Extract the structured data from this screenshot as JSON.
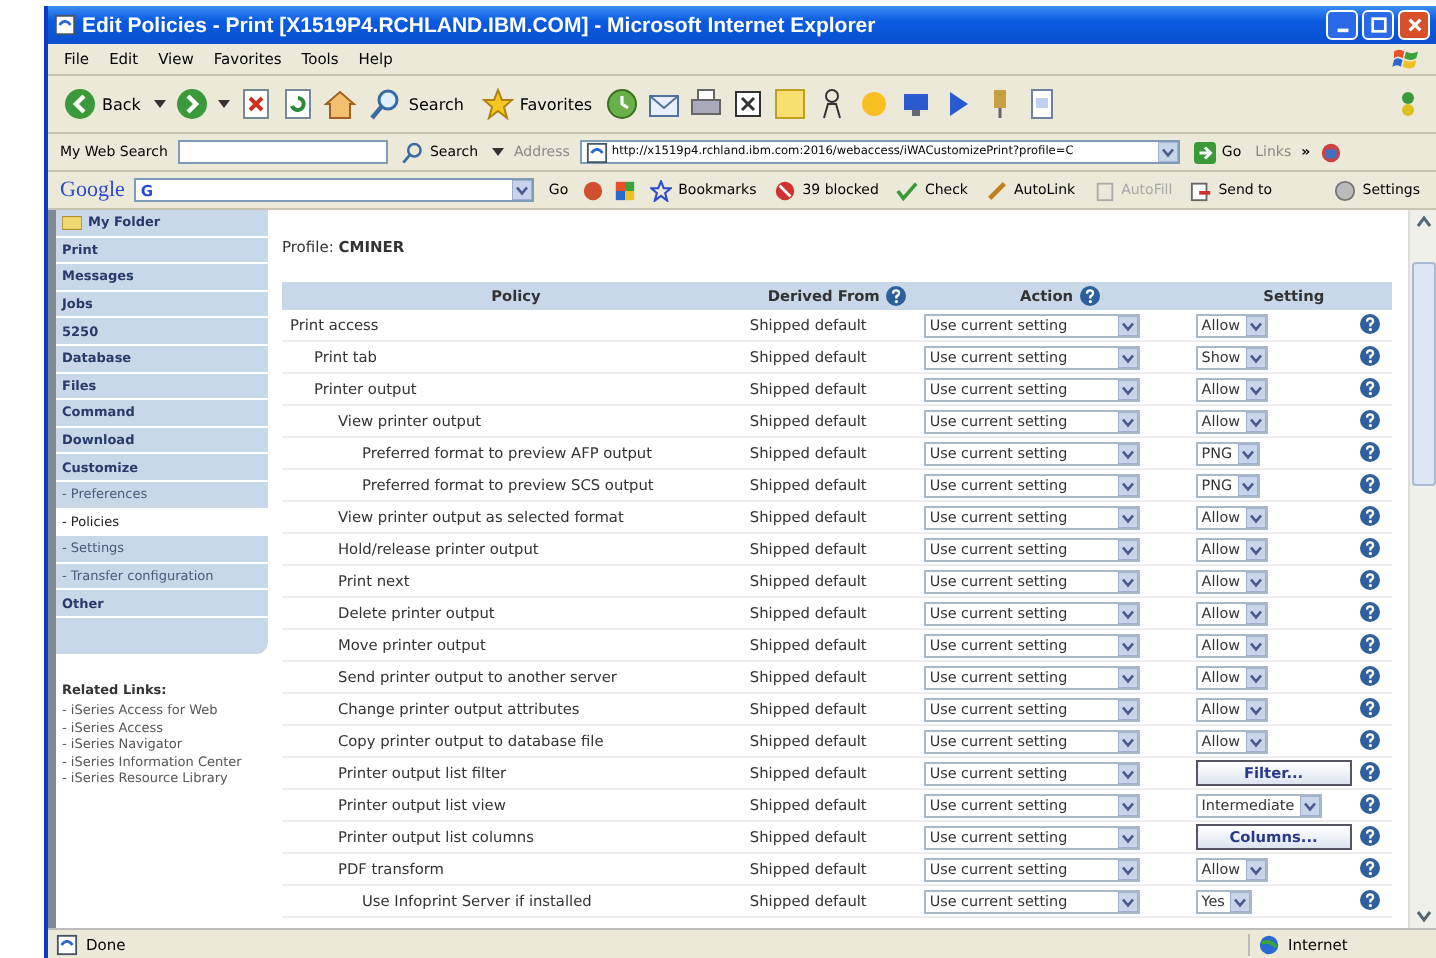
{
  "window": {
    "title": "Edit Policies - Print [X1519P4.RCHLAND.IBM.COM] - Microsoft Internet Explorer"
  },
  "menu": [
    "File",
    "Edit",
    "View",
    "Favorites",
    "Tools",
    "Help"
  ],
  "toolbar": {
    "back": "Back",
    "search": "Search",
    "favorites": "Favorites"
  },
  "address_bar": {
    "search_label": "My Web Search",
    "search_button": "Search",
    "address_label": "Address",
    "url": "http://x1519p4.rchland.ibm.com:2016/webaccess/iWACustomizePrint?profile=C",
    "go": "Go",
    "links": "Links",
    "links_more": "»"
  },
  "google_bar": {
    "logo": "Google",
    "field": "G",
    "go": "Go",
    "bookmarks": "Bookmarks",
    "blocked": "39 blocked",
    "check": "Check",
    "autolink": "AutoLink",
    "autofill": "AutoFill",
    "autofill_disabled": true,
    "send_to": "Send to",
    "settings": "Settings"
  },
  "sidebar": {
    "items": [
      {
        "label": "My Folder",
        "kind": "folder",
        "selected": false
      },
      {
        "label": "Print",
        "kind": "main",
        "selected": false
      },
      {
        "label": "Messages",
        "kind": "main",
        "selected": false
      },
      {
        "label": "Jobs",
        "kind": "main",
        "selected": false
      },
      {
        "label": "5250",
        "kind": "main",
        "selected": false
      },
      {
        "label": "Database",
        "kind": "main",
        "selected": false
      },
      {
        "label": "Files",
        "kind": "main",
        "selected": false
      },
      {
        "label": "Command",
        "kind": "main",
        "selected": false
      },
      {
        "label": "Download",
        "kind": "main",
        "selected": false
      },
      {
        "label": "Customize",
        "kind": "main",
        "selected": false
      },
      {
        "label": "- Preferences",
        "kind": "sub",
        "selected": false
      },
      {
        "label": "- Policies",
        "kind": "sub",
        "selected": true
      },
      {
        "label": "- Settings",
        "kind": "sub",
        "selected": false
      },
      {
        "label": "- Transfer configuration",
        "kind": "sub",
        "selected": false
      },
      {
        "label": "Other",
        "kind": "main",
        "selected": false
      }
    ],
    "related_title": "Related Links:",
    "related_links": [
      "- iSeries Access for Web",
      "- iSeries Access",
      "- iSeries Navigator",
      "- iSeries Information Center",
      "- iSeries Resource Library"
    ]
  },
  "profile": {
    "label": "Profile:",
    "value": "CMINER"
  },
  "table": {
    "columns": [
      {
        "label": "Policy",
        "help": false
      },
      {
        "label": "Derived From",
        "help": true
      },
      {
        "label": "Action",
        "help": true
      },
      {
        "label": "Setting",
        "help": false
      }
    ],
    "rows": [
      {
        "policy": "Print access",
        "derived": "Shipped default",
        "action": "Use current setting",
        "setting": {
          "kind": "select",
          "value": "Allow"
        },
        "children": [
          {
            "policy": "Print tab",
            "derived": "Shipped default",
            "action": "Use current setting",
            "setting": {
              "kind": "select",
              "value": "Show"
            }
          },
          {
            "policy": "Printer output",
            "derived": "Shipped default",
            "action": "Use current setting",
            "setting": {
              "kind": "select",
              "value": "Allow"
            },
            "children": [
              {
                "policy": "View printer output",
                "derived": "Shipped default",
                "action": "Use current setting",
                "setting": {
                  "kind": "select",
                  "value": "Allow"
                },
                "children": [
                  {
                    "policy": "Preferred format to preview AFP output",
                    "derived": "Shipped default",
                    "action": "Use current setting",
                    "setting": {
                      "kind": "select",
                      "value": "PNG"
                    }
                  },
                  {
                    "policy": "Preferred format to preview SCS output",
                    "derived": "Shipped default",
                    "action": "Use current setting",
                    "setting": {
                      "kind": "select",
                      "value": "PNG"
                    }
                  }
                ]
              },
              {
                "policy": "View printer output as selected format",
                "derived": "Shipped default",
                "action": "Use current setting",
                "setting": {
                  "kind": "select",
                  "value": "Allow"
                }
              },
              {
                "policy": "Hold/release printer output",
                "derived": "Shipped default",
                "action": "Use current setting",
                "setting": {
                  "kind": "select",
                  "value": "Allow"
                }
              },
              {
                "policy": "Print next",
                "derived": "Shipped default",
                "action": "Use current setting",
                "setting": {
                  "kind": "select",
                  "value": "Allow"
                }
              },
              {
                "policy": "Delete printer output",
                "derived": "Shipped default",
                "action": "Use current setting",
                "setting": {
                  "kind": "select",
                  "value": "Allow"
                }
              },
              {
                "policy": "Move printer output",
                "derived": "Shipped default",
                "action": "Use current setting",
                "setting": {
                  "kind": "select",
                  "value": "Allow"
                }
              },
              {
                "policy": "Send printer output to another server",
                "derived": "Shipped default",
                "action": "Use current setting",
                "setting": {
                  "kind": "select",
                  "value": "Allow"
                }
              },
              {
                "policy": "Change printer output attributes",
                "derived": "Shipped default",
                "action": "Use current setting",
                "setting": {
                  "kind": "select",
                  "value": "Allow"
                }
              },
              {
                "policy": "Copy printer output to database file",
                "derived": "Shipped default",
                "action": "Use current setting",
                "setting": {
                  "kind": "select",
                  "value": "Allow"
                }
              },
              {
                "policy": "Printer output list filter",
                "derived": "Shipped default",
                "action": "Use current setting",
                "setting": {
                  "kind": "button",
                  "value": "Filter..."
                }
              },
              {
                "policy": "Printer output list view",
                "derived": "Shipped default",
                "action": "Use current setting",
                "setting": {
                  "kind": "select",
                  "value": "Intermediate"
                }
              },
              {
                "policy": "Printer output list columns",
                "derived": "Shipped default",
                "action": "Use current setting",
                "setting": {
                  "kind": "button",
                  "value": "Columns..."
                }
              },
              {
                "policy": "PDF transform",
                "derived": "Shipped default",
                "action": "Use current setting",
                "setting": {
                  "kind": "select",
                  "value": "Allow"
                },
                "children": [
                  {
                    "policy": "Use Infoprint Server if installed",
                    "derived": "Shipped default",
                    "action": "Use current setting",
                    "setting": {
                      "kind": "select",
                      "value": "Yes"
                    }
                  }
                ]
              }
            ]
          }
        ]
      }
    ]
  },
  "status_bar": {
    "status": "Done",
    "zone": "Internet"
  }
}
